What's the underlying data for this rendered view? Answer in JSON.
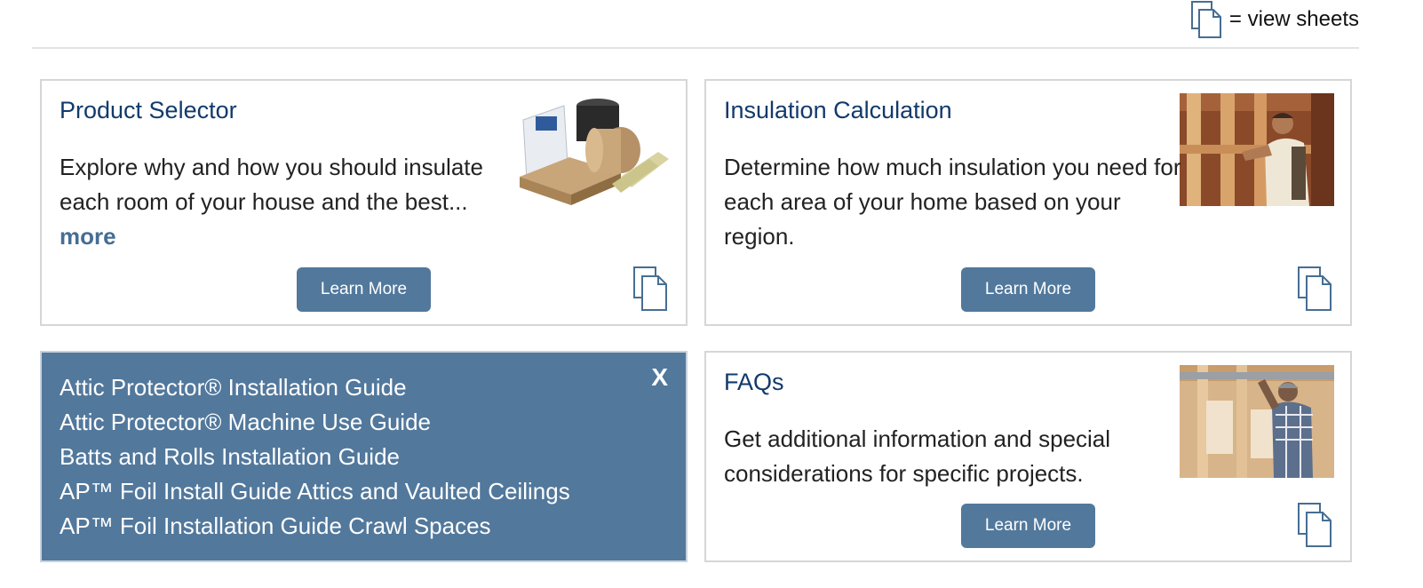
{
  "legend": {
    "icon": "view-sheets-icon",
    "label": "= view sheets"
  },
  "cards": {
    "product_selector": {
      "title": "Product Selector",
      "description": "Explore why and how you should insulate each room of your house and the best...",
      "more": "more",
      "button": "Learn More",
      "image": "insulation-products-image"
    },
    "insulation_calculation": {
      "title": "Insulation Calculation",
      "description": "Determine how much insulation you need for each area of your home based on your region.",
      "button": "Learn More",
      "image": "worker-framing-image"
    },
    "faqs": {
      "title": "FAQs",
      "description": "Get additional information and special considerations for specific projects.",
      "button": "Learn More",
      "image": "installer-attic-image"
    }
  },
  "guides_panel": {
    "close": "X",
    "items": [
      "Attic Protector® Installation Guide",
      "Attic Protector® Machine Use Guide",
      "Batts and Rolls Installation Guide",
      "AP™ Foil Install Guide Attics and Vaulted Ceilings",
      "AP™ Foil Installation Guide Crawl Spaces"
    ]
  },
  "colors": {
    "accent": "#52789c",
    "title": "#123a6b",
    "more_link": "#466e94",
    "border": "#d6d6d6"
  }
}
